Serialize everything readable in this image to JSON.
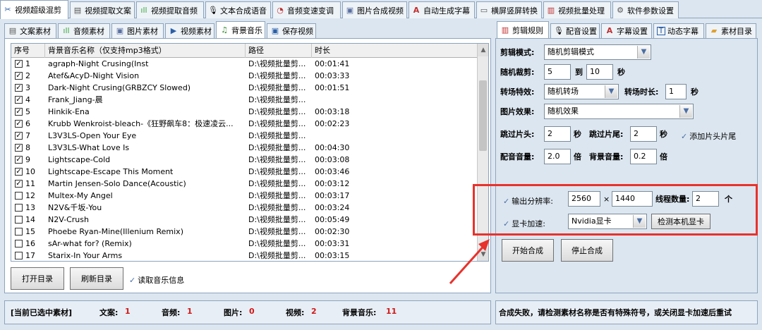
{
  "top_tabs": [
    {
      "label": "视频超级混剪",
      "icon": "scissors-icon"
    },
    {
      "label": "视频提取文案",
      "icon": "document-icon"
    },
    {
      "label": "视频提取音频",
      "icon": "audio-wave-icon"
    },
    {
      "label": "文本合成语音",
      "icon": "microphone-icon"
    },
    {
      "label": "音频变速变调",
      "icon": "speedometer-icon"
    },
    {
      "label": "图片合成视频",
      "icon": "image-icon"
    },
    {
      "label": "自动生成字幕",
      "icon": "subtitle-icon"
    },
    {
      "label": "横屏竖屏转换",
      "icon": "screen-rotate-icon"
    },
    {
      "label": "视频批量处理",
      "icon": "film-icon"
    },
    {
      "label": "软件参数设置",
      "icon": "gear-icon"
    }
  ],
  "left_tabs": [
    {
      "label": "文案素材",
      "icon": "document-icon"
    },
    {
      "label": "音频素材",
      "icon": "audio-wave-icon"
    },
    {
      "label": "图片素材",
      "icon": "image-icon"
    },
    {
      "label": "视频素材",
      "icon": "play-icon"
    },
    {
      "label": "背景音乐",
      "icon": "music-note-icon"
    },
    {
      "label": "保存视频",
      "icon": "save-icon"
    }
  ],
  "table": {
    "headers": [
      "序号",
      "背景音乐名称（仅支持mp3格式）",
      "路径",
      "时长"
    ],
    "rows": [
      {
        "num": "1",
        "checked": true,
        "name": "agraph-Night Crusing(Inst",
        "path": "D:\\视频批量剪...",
        "duration": "00:01:41"
      },
      {
        "num": "2",
        "checked": true,
        "name": "Atef&AcyD-Night Vision",
        "path": "D:\\视频批量剪...",
        "duration": "00:03:33"
      },
      {
        "num": "3",
        "checked": true,
        "name": "Dark-Night Crusing(GRBZCY Slowed)",
        "path": "D:\\视频批量剪...",
        "duration": "00:01:51"
      },
      {
        "num": "4",
        "checked": true,
        "name": "Frank_Jiang-晨",
        "path": "D:\\视频批量剪...",
        "duration": ""
      },
      {
        "num": "5",
        "checked": true,
        "name": "Hinkik-Ena",
        "path": "D:\\视频批量剪...",
        "duration": "00:03:18"
      },
      {
        "num": "6",
        "checked": true,
        "name": "Krubb Wenkroist-bleach-《狂野飙车8：极速凌云...",
        "path": "D:\\视频批量剪...",
        "duration": "00:02:23"
      },
      {
        "num": "7",
        "checked": true,
        "name": "L3V3LS-Open Your Eye",
        "path": "D:\\视频批量剪...",
        "duration": ""
      },
      {
        "num": "8",
        "checked": true,
        "name": "L3V3LS-What Love Is",
        "path": "D:\\视频批量剪...",
        "duration": "00:04:30"
      },
      {
        "num": "9",
        "checked": true,
        "name": "Lightscape-Cold",
        "path": "D:\\视频批量剪...",
        "duration": "00:03:08"
      },
      {
        "num": "10",
        "checked": true,
        "name": "Lightscape-Escape This Moment",
        "path": "D:\\视频批量剪...",
        "duration": "00:03:46"
      },
      {
        "num": "11",
        "checked": true,
        "name": "Martin Jensen-Solo Dance(Acoustic)",
        "path": "D:\\视频批量剪...",
        "duration": "00:03:12"
      },
      {
        "num": "12",
        "checked": false,
        "name": "Multex-My Angel",
        "path": "D:\\视频批量剪...",
        "duration": "00:03:17"
      },
      {
        "num": "13",
        "checked": false,
        "name": "N2V&千坂-You",
        "path": "D:\\视频批量剪...",
        "duration": "00:03:24"
      },
      {
        "num": "14",
        "checked": false,
        "name": "N2V-Crush",
        "path": "D:\\视频批量剪...",
        "duration": "00:05:49"
      },
      {
        "num": "15",
        "checked": false,
        "name": "Phoebe Ryan-Mine(Illenium Remix)",
        "path": "D:\\视频批量剪...",
        "duration": "00:02:30"
      },
      {
        "num": "16",
        "checked": false,
        "name": "sAr-what for? (Remix)",
        "path": "D:\\视频批量剪...",
        "duration": "00:03:31"
      },
      {
        "num": "17",
        "checked": false,
        "name": "Starix-In Your Arms",
        "path": "D:\\视频批量剪...",
        "duration": "00:03:15"
      }
    ]
  },
  "left_buttons": {
    "open_dir": "打开目录",
    "refresh_dir": "刷新目录",
    "read_info": "读取音乐信息"
  },
  "right_tabs": [
    {
      "label": "剪辑规则",
      "icon": "film-icon"
    },
    {
      "label": "配音设置",
      "icon": "microphone-icon"
    },
    {
      "label": "字幕设置",
      "icon": "subtitle-icon"
    },
    {
      "label": "动态字幕",
      "icon": "text-icon"
    },
    {
      "label": "素材目录",
      "icon": "folder-icon"
    }
  ],
  "settings": {
    "mode_label": "剪辑模式:",
    "mode_value": "随机剪辑模式",
    "crop_label": "随机裁剪:",
    "crop_from": "5",
    "crop_to_label": "到",
    "crop_to": "10",
    "crop_unit": "秒",
    "transition_label": "转场特效:",
    "transition_value": "随机转场",
    "transition_dur_label": "转场时长:",
    "transition_dur": "1",
    "transition_unit": "秒",
    "image_effect_label": "图片效果:",
    "image_effect_value": "随机效果",
    "skip_head_label": "跳过片头:",
    "skip_head": "2",
    "skip_head_unit": "秒",
    "skip_tail_label": "跳过片尾:",
    "skip_tail": "2",
    "skip_tail_unit": "秒",
    "add_head_tail": "添加片头片尾",
    "voice_vol_label": "配音音量:",
    "voice_vol": "2.0",
    "voice_vol_unit": "倍",
    "bg_vol_label": "背景音量:",
    "bg_vol": "0.2",
    "bg_vol_unit": "倍",
    "resolution_label": "输出分辨率:",
    "res_w": "2560",
    "res_x": "×",
    "res_h": "1440",
    "threads_label": "线程数量:",
    "threads": "2",
    "threads_unit": "个",
    "gpu_label": "显卡加速:",
    "gpu_value": "Nvidia显卡",
    "detect_gpu": "检测本机显卡",
    "start": "开始合成",
    "stop": "停止合成"
  },
  "status": {
    "selected_label": "[当前已选中素材]",
    "text_label": "文案:",
    "text_count": "1",
    "audio_label": "音频:",
    "audio_count": "1",
    "image_label": "图片:",
    "image_count": "0",
    "video_label": "视频:",
    "video_count": "2",
    "bgm_label": "背景音乐:",
    "bgm_count": "11",
    "message": "合成失败，请检测素材名称是否有特殊符号，或关闭显卡加速后重试"
  },
  "colors": {
    "highlight_red": "#e8322c",
    "count_red": "#d01818",
    "panel_bg": "#dce6f0"
  }
}
